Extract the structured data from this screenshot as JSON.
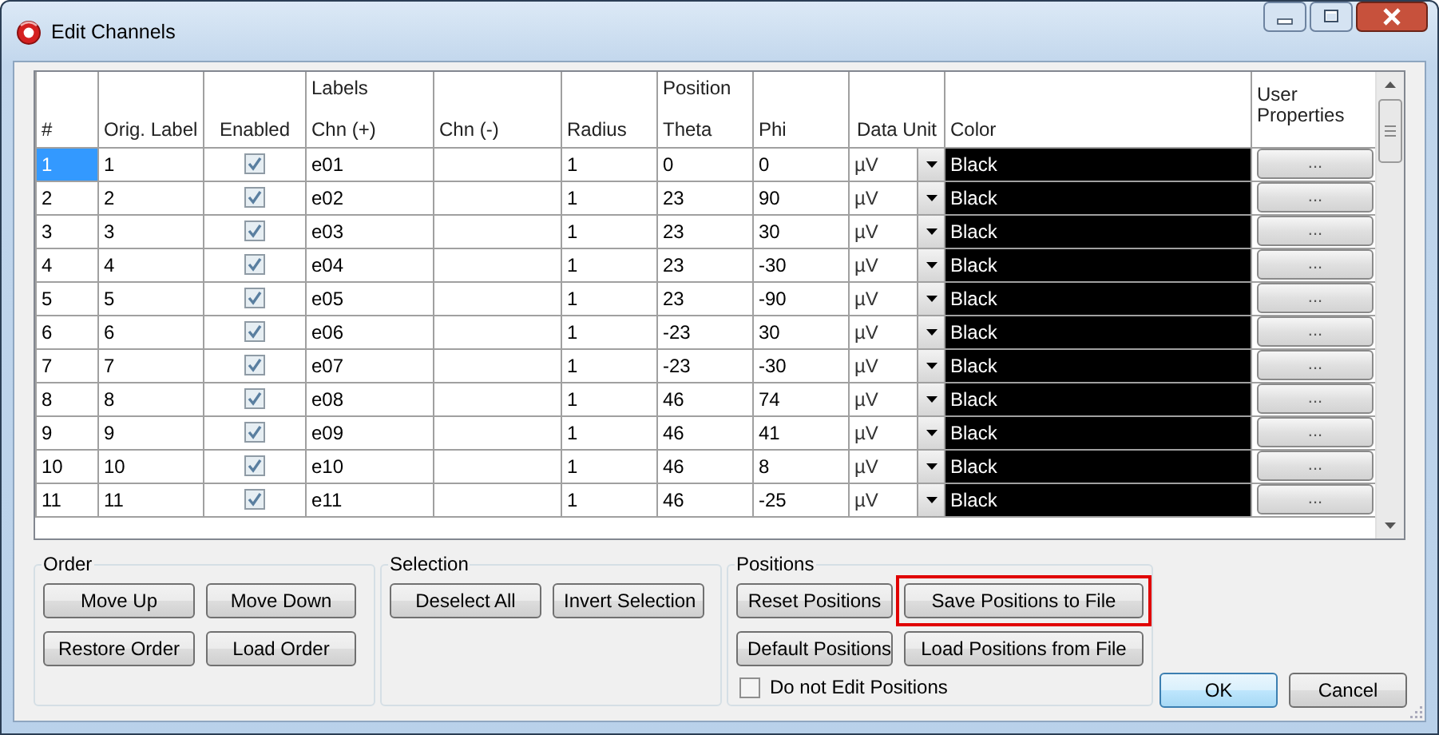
{
  "window": {
    "title": "Edit Channels"
  },
  "table": {
    "columns": [
      {
        "label": "#"
      },
      {
        "label": "Orig. Label"
      },
      {
        "label": "Enabled"
      },
      {
        "group": "Labels",
        "label": "Chn (+)"
      },
      {
        "label": "Chn (-)"
      },
      {
        "label": "Radius"
      },
      {
        "group": "Position",
        "label": "Theta"
      },
      {
        "label": "Phi"
      },
      {
        "label": "Data Unit"
      },
      {
        "label": "Color"
      },
      {
        "label": "User Properties"
      }
    ],
    "rows": [
      {
        "number": "1",
        "orig_label": "1",
        "enabled": true,
        "chn_plus": "e01",
        "chn_minus": "",
        "radius": "1",
        "theta": "0",
        "phi": "0",
        "data_unit": "µV",
        "color_name": "Black",
        "color": "#000000",
        "user_properties": "...",
        "selected": true
      },
      {
        "number": "2",
        "orig_label": "2",
        "enabled": true,
        "chn_plus": "e02",
        "radius": "1",
        "theta": "23",
        "phi": "90",
        "data_unit": "µV",
        "color_name": "Black",
        "color": "#000000",
        "user_properties": "...",
        "selected": false
      },
      {
        "number": "3",
        "orig_label": "3",
        "enabled": true,
        "chn_plus": "e03",
        "radius": "1",
        "theta": "23",
        "phi": "30",
        "data_unit": "µV",
        "color_name": "Black",
        "color": "#000000",
        "user_properties": "...",
        "selected": false
      },
      {
        "number": "4",
        "orig_label": "4",
        "enabled": true,
        "chn_plus": "e04",
        "radius": "1",
        "theta": "23",
        "phi": "-30",
        "data_unit": "µV",
        "color_name": "Black",
        "color": "#000000",
        "user_properties": "...",
        "selected": false
      },
      {
        "number": "5",
        "orig_label": "5",
        "enabled": true,
        "chn_plus": "e05",
        "radius": "1",
        "theta": "23",
        "phi": "-90",
        "data_unit": "µV",
        "color_name": "Black",
        "color": "#000000",
        "user_properties": "...",
        "selected": false
      },
      {
        "number": "6",
        "orig_label": "6",
        "enabled": true,
        "chn_plus": "e06",
        "radius": "1",
        "theta": "-23",
        "phi": "30",
        "data_unit": "µV",
        "color_name": "Black",
        "color": "#000000",
        "user_properties": "...",
        "selected": false
      },
      {
        "number": "7",
        "orig_label": "7",
        "enabled": true,
        "chn_plus": "e07",
        "radius": "1",
        "theta": "-23",
        "phi": "-30",
        "data_unit": "µV",
        "color_name": "Black",
        "color": "#000000",
        "user_properties": "...",
        "selected": false
      },
      {
        "number": "8",
        "orig_label": "8",
        "enabled": true,
        "chn_plus": "e08",
        "radius": "1",
        "theta": "46",
        "phi": "74",
        "data_unit": "µV",
        "color_name": "Black",
        "color": "#000000",
        "user_properties": "...",
        "selected": false
      },
      {
        "number": "9",
        "orig_label": "9",
        "enabled": true,
        "chn_plus": "e09",
        "radius": "1",
        "theta": "46",
        "phi": "41",
        "data_unit": "µV",
        "color_name": "Black",
        "color": "#000000",
        "user_properties": "...",
        "selected": false
      },
      {
        "number": "10",
        "orig_label": "10",
        "enabled": true,
        "chn_plus": "e10",
        "radius": "1",
        "theta": "46",
        "phi": "8",
        "data_unit": "µV",
        "color_name": "Black",
        "color": "#000000",
        "user_properties": "...",
        "selected": false
      },
      {
        "number": "11",
        "orig_label": "11",
        "enabled": true,
        "chn_plus": "e11",
        "radius": "1",
        "theta": "46",
        "phi": "-25",
        "data_unit": "µV",
        "color_name": "Black",
        "color": "#000000",
        "user_properties": "...",
        "selected": false
      }
    ]
  },
  "groups": [
    {
      "title": "Order",
      "buttons": [
        {
          "label": "Move Up",
          "highlighted": false
        },
        {
          "label": "Move Down",
          "highlighted": false
        },
        {
          "label": "Restore Order",
          "highlighted": false
        },
        {
          "label": "Load Order",
          "highlighted": false
        }
      ]
    },
    {
      "title": "Selection",
      "buttons": [
        {
          "label": "Deselect All",
          "highlighted": false
        },
        {
          "label": "Invert Selection",
          "highlighted": false
        }
      ]
    },
    {
      "title": "Positions",
      "buttons": [
        {
          "label": "Reset Positions",
          "highlighted": false
        },
        {
          "label": "Save Positions to File",
          "highlighted": true
        },
        {
          "label": "Default Positions",
          "highlighted": false
        },
        {
          "label": "Load Positions from File",
          "highlighted": false
        }
      ],
      "checkbox": {
        "label": "Do not Edit Positions",
        "checked": false
      }
    }
  ],
  "dialog_buttons": [
    {
      "label": "OK",
      "default": true
    },
    {
      "label": "Cancel",
      "default": false
    }
  ]
}
